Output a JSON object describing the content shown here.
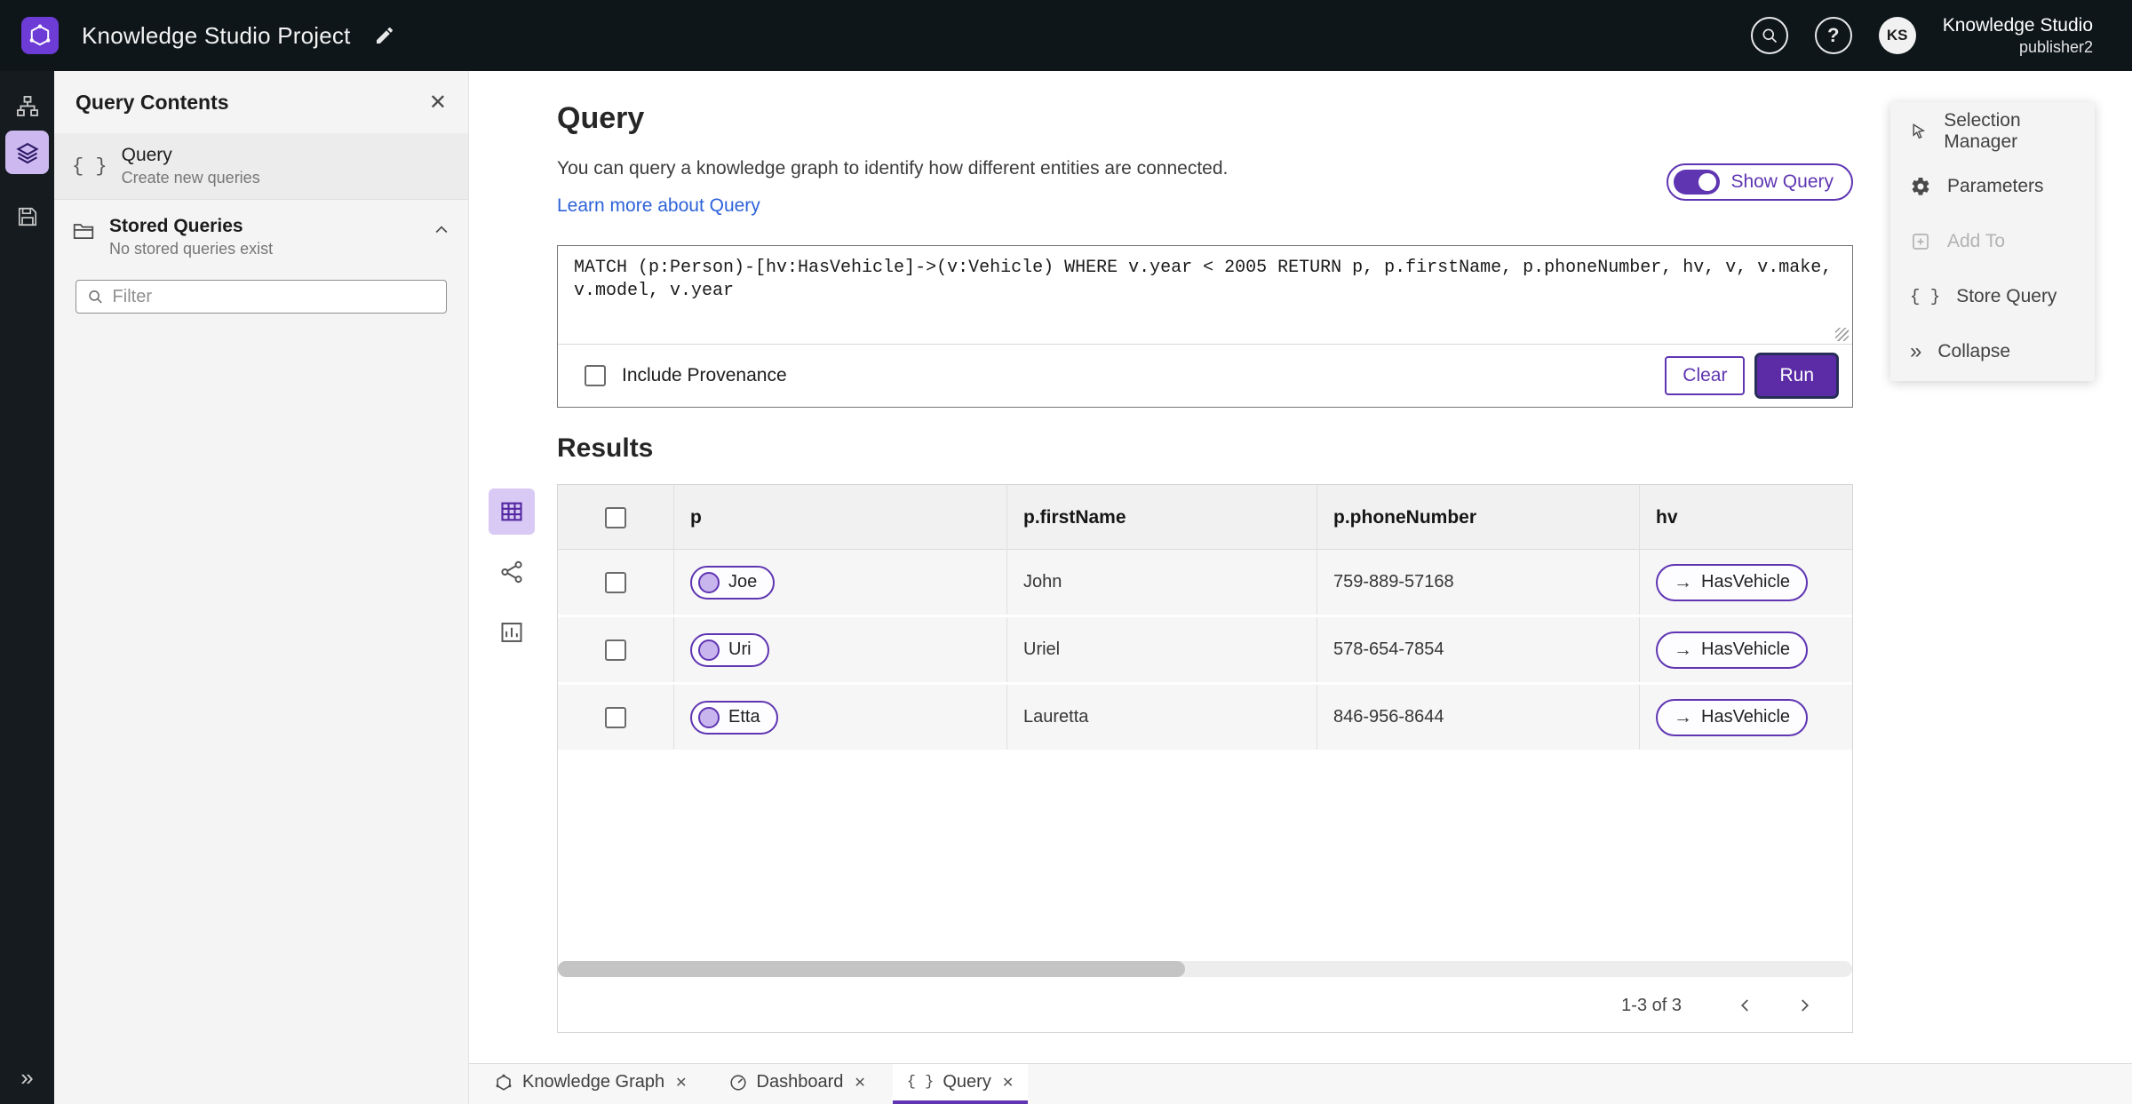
{
  "topbar": {
    "title": "Knowledge Studio Project",
    "user_initials": "KS",
    "user_name": "Knowledge Studio",
    "user_role": "publisher2"
  },
  "sidebar": {
    "title": "Query Contents",
    "query_item_title": "Query",
    "query_item_subtitle": "Create new queries",
    "stored_title": "Stored Queries",
    "stored_subtitle": "No stored queries exist",
    "filter_placeholder": "Filter"
  },
  "query_panel": {
    "title": "Query",
    "description": "You can query a knowledge graph to identify how different entities are connected.",
    "learn_more": "Learn more about Query",
    "show_query_label": "Show Query",
    "query_text": "MATCH (p:Person)-[hv:HasVehicle]->(v:Vehicle) WHERE v.year < 2005 RETURN p, p.firstName, p.phoneNumber, hv, v, v.make, v.model, v.year",
    "include_provenance_label": "Include Provenance",
    "clear_label": "Clear",
    "run_label": "Run"
  },
  "results": {
    "title": "Results",
    "columns": [
      "p",
      "p.firstName",
      "p.phoneNumber",
      "hv"
    ],
    "rows": [
      {
        "p": "Joe",
        "firstName": "John",
        "phoneNumber": "759-889-57168",
        "hv": "HasVehicle"
      },
      {
        "p": "Uri",
        "firstName": "Uriel",
        "phoneNumber": "578-654-7854",
        "hv": "HasVehicle"
      },
      {
        "p": "Etta",
        "firstName": "Lauretta",
        "phoneNumber": "846-956-8644",
        "hv": "HasVehicle"
      }
    ],
    "pagination": "1-3 of 3"
  },
  "context_menu": {
    "items": [
      {
        "label": "Selection Manager"
      },
      {
        "label": "Parameters"
      },
      {
        "label": "Add To"
      },
      {
        "label": "Store Query"
      },
      {
        "label": "Collapse"
      }
    ]
  },
  "tabs": [
    {
      "label": "Knowledge Graph"
    },
    {
      "label": "Dashboard"
    },
    {
      "label": "Query"
    }
  ],
  "icons": {
    "braces": "{ }",
    "collapse_glyph": "»",
    "question": "?",
    "arrow_right": "→",
    "close": "✕"
  },
  "colors": {
    "accent_purple": "#5f35b2",
    "run_button": "#5b2ca6",
    "topbar_bg": "#0e161a",
    "link_blue": "#2e62d9",
    "panel_gray": "#f4f4f4"
  }
}
